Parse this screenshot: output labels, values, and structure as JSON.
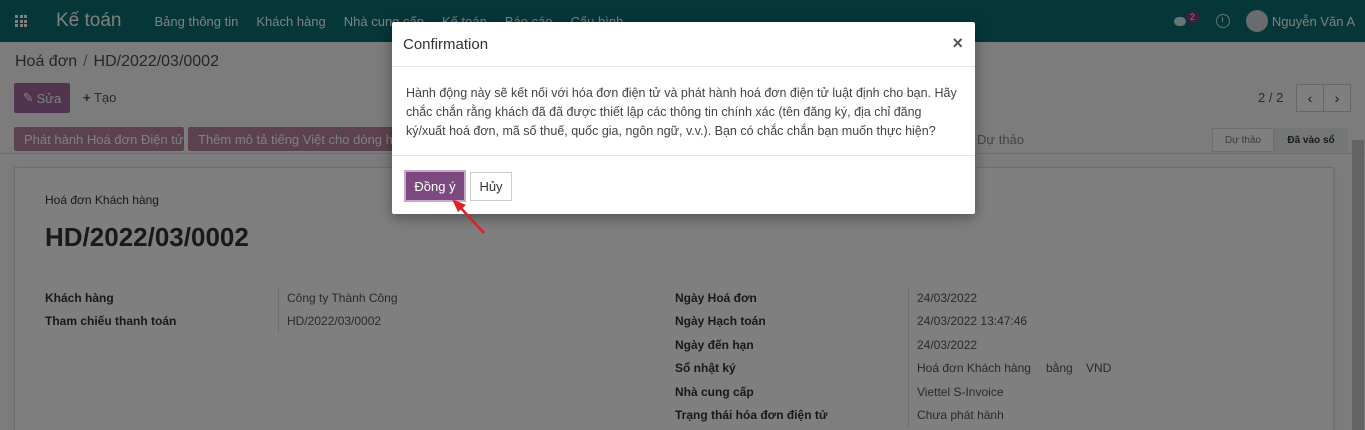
{
  "navbar": {
    "app_title": "Kế toán",
    "menu": [
      "Bảng thông tin",
      "Khách hàng",
      "Nhà cung cấp",
      "Kế toán",
      "Báo cáo",
      "Cấu hình"
    ],
    "chat_count": "2",
    "user_name": "Nguyễn Văn A",
    "icons": [
      "apps-grid-icon",
      "chat-icon",
      "clock-icon",
      "avatar"
    ]
  },
  "breadcrumb": {
    "parent": "Hoá đơn",
    "separator": "/",
    "current": "HD/2022/03/0002"
  },
  "actions": {
    "edit_label": "Sửa",
    "create_label": "Tạo"
  },
  "pager": {
    "text": "2 / 2",
    "prev": "‹",
    "next": "›"
  },
  "statusbar": {
    "issue_button": "Phát hành Hoá đơn Điện tử",
    "desc_button": "Thêm mô tả tiếng Việt cho dòng ho",
    "draft_text": "Dự thảo",
    "stage_draft": "Dự thảo",
    "stage_posted": "Đã vào sổ"
  },
  "sheet": {
    "type_label": "Hoá đơn Khách hàng",
    "number": "HD/2022/03/0002",
    "left_fields": [
      {
        "label": "Khách hàng",
        "value": "Công ty Thành Công"
      },
      {
        "label": "Tham chiếu thanh toán",
        "value": "HD/2022/03/0002"
      }
    ],
    "right_fields": [
      {
        "label": "Ngày Hoá đơn",
        "value": "24/03/2022"
      },
      {
        "label": "Ngày Hạch toán",
        "value": "24/03/2022 13:47:46"
      },
      {
        "label": "Ngày đến hạn",
        "value": "24/03/2022"
      },
      {
        "label": "Sổ nhật ký",
        "value": "Hoá đơn Khách hàng",
        "value2": "bằng",
        "value3": "VND"
      },
      {
        "label": "Nhà cung cấp",
        "value": "Viettel S-Invoice"
      },
      {
        "label": "Trạng thái hóa đơn điện tử",
        "value": "Chưa phát hành"
      }
    ]
  },
  "dialog": {
    "title": "Confirmation",
    "close": "×",
    "message": "Hành động này sẽ kết nối với hóa đơn điện tử và phát hành hoá đơn điện tử luật định cho bạn. Hãy chắc chắn rằng khách đã đã được thiết lập các thông tin chính xác (tên đăng ký, địa chỉ đăng ký/xuất hoá đơn, mã số thuế, quốc gia, ngôn ngữ, v.v.). Bạn có chắc chắn bạn muốn thực hiện?",
    "confirm_label": "Đồng ý",
    "cancel_label": "Hủy"
  },
  "colors": {
    "navbar": "#0b6f70",
    "primary": "#7c4a80",
    "annotation_arrow": "#e02020"
  }
}
